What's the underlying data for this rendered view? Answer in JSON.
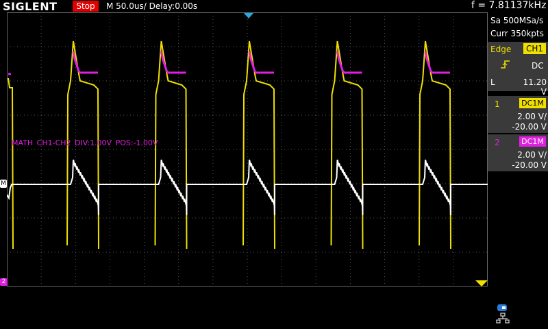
{
  "header": {
    "brand": "SIGLENT",
    "run_state": "Stop",
    "timebase": "M 50.0us/",
    "delay": "Delay:0.00s",
    "frequency": "f = 7.81137kHz"
  },
  "acquisition": {
    "sample_rate": "Sa 500MSa/s",
    "memory_depth": "Curr 350kpts"
  },
  "trigger": {
    "mode": "Edge",
    "source": "CH1",
    "slope_icon": "rising-edge-icon",
    "coupling": "DC",
    "level_label": "L",
    "level": "11.20 V"
  },
  "channels": [
    {
      "number": "1",
      "coupling": "DC1M",
      "scale": "2.00 V/",
      "offset": "-20.00 V",
      "color": "#f0e000"
    },
    {
      "number": "2",
      "coupling": "DC1M",
      "scale": "2.00 V/",
      "offset": "-20.00 V",
      "color": "#e020e0"
    }
  ],
  "math": {
    "label": "MATH  CH1-CH2  DIV:1.00V  POS:-1.00V",
    "marker": "M",
    "color": "#ffffff"
  },
  "markers": {
    "ch2_ground": "2"
  },
  "colors": {
    "ch1": "#f0e000",
    "ch2": "#e020e0",
    "math": "#ffffff",
    "trigger_position": "#2aa8e0",
    "stop_badge": "#e00000",
    "grid": "#5a5a5a"
  },
  "status_icons": [
    "usb-icon",
    "lan-icon"
  ]
}
